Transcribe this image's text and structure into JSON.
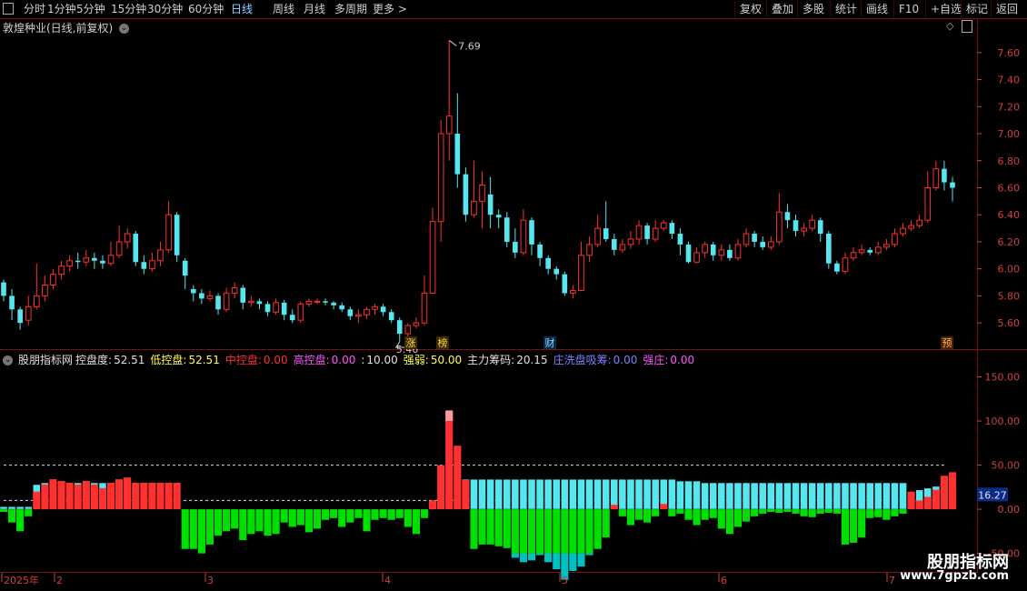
{
  "toolbar": {
    "periods": [
      "分时",
      "1分钟",
      "5分钟",
      "15分钟",
      "30分钟",
      "60分钟",
      "日线",
      "周线",
      "月线",
      "多周期",
      "更多 >"
    ],
    "active_period": "日线",
    "right_buttons": [
      "复权",
      "叠加",
      "多股",
      "统计",
      "画线",
      "F10",
      "+自选",
      "标记",
      "返回"
    ]
  },
  "price_panel": {
    "title": "敦煌种业(日线,前复权)",
    "axis_ticks": [
      "7.60",
      "7.40",
      "7.20",
      "7.00",
      "6.80",
      "6.60",
      "6.40",
      "6.20",
      "6.00",
      "5.80",
      "5.60"
    ],
    "high_label": "7.69",
    "low_label": "5.46",
    "tags": [
      {
        "text": "涨",
        "color": "#ffd24a",
        "bg": "#3a2a00"
      },
      {
        "text": "榜",
        "color": "#ffd24a",
        "bg": "#3a2a00"
      },
      {
        "text": "财",
        "color": "#8fd3ff",
        "bg": "#0a2a4a"
      },
      {
        "text": "预",
        "color": "#ffb060",
        "bg": "#4a2400"
      }
    ]
  },
  "indicator_panel": {
    "name": "股朋指标网",
    "fields": [
      {
        "label": "控盘度:",
        "value": "52.51",
        "color": "#e0e0e0"
      },
      {
        "label": "低控盘:",
        "value": "52.51",
        "color": "#ffff55"
      },
      {
        "label": "中控盘:",
        "value": "0.00",
        "color": "#ff3030"
      },
      {
        "label": "高控盘:",
        "value": "0.00",
        "color": "#ff55ff"
      },
      {
        "label": ":",
        "value": "10.00",
        "color": "#e0e0e0"
      },
      {
        "label": "强弱:",
        "value": "50.00",
        "color": "#ffff55"
      },
      {
        "label": "主力筹码:",
        "value": "20.15",
        "color": "#e0e0e0"
      },
      {
        "label": "庄洗盘吸筹:",
        "value": "0.00",
        "color": "#8080ff"
      },
      {
        "label": "强庄:",
        "value": "0.00",
        "color": "#ff55ff"
      }
    ],
    "axis_ticks": [
      "150.00",
      "100.00",
      "50.00",
      "0.00",
      "-50.00"
    ],
    "current_value": "16.27"
  },
  "date_axis": [
    "2025年",
    "2",
    "3",
    "4",
    "5",
    "6",
    "7"
  ],
  "watermark": {
    "cn": "股朋指标网",
    "url": "www.7gpzb.com"
  },
  "colors": {
    "up": "#ff3030",
    "down": "#55e6f0",
    "green": "#00e000",
    "teal": "#00c0c0",
    "grid": "#7a1010"
  },
  "chart_data": {
    "type": "candlestick",
    "series": [
      {
        "values": [
          [
            5.9,
            5.8,
            5.92,
            5.76
          ],
          [
            5.8,
            5.7,
            5.85,
            5.62
          ],
          [
            5.7,
            5.6,
            5.72,
            5.55
          ],
          [
            5.62,
            5.72,
            5.8,
            5.58
          ],
          [
            5.72,
            5.8,
            6.04,
            5.7
          ],
          [
            5.8,
            5.88,
            5.95,
            5.76
          ],
          [
            5.88,
            5.96,
            6.0,
            5.85
          ],
          [
            5.96,
            6.02,
            6.06,
            5.92
          ],
          [
            6.02,
            6.06,
            6.1,
            5.98
          ],
          [
            6.06,
            6.05,
            6.12,
            6.0
          ],
          [
            6.05,
            6.08,
            6.14,
            6.02
          ],
          [
            6.08,
            6.06,
            6.12,
            6.0
          ],
          [
            6.06,
            6.04,
            6.1,
            6.0
          ],
          [
            6.04,
            6.1,
            6.2,
            6.02
          ],
          [
            6.1,
            6.2,
            6.32,
            6.08
          ],
          [
            6.2,
            6.26,
            6.3,
            6.15
          ],
          [
            6.26,
            6.05,
            6.28,
            6.02
          ],
          [
            6.05,
            6.0,
            6.1,
            5.96
          ],
          [
            6.0,
            6.06,
            6.12,
            5.98
          ],
          [
            6.06,
            6.14,
            6.2,
            6.02
          ],
          [
            6.14,
            6.4,
            6.5,
            6.12
          ],
          [
            6.4,
            6.1,
            6.42,
            6.05
          ],
          [
            6.06,
            5.95,
            6.08,
            5.85
          ],
          [
            5.85,
            5.82,
            5.88,
            5.76
          ],
          [
            5.82,
            5.78,
            5.85,
            5.74
          ],
          [
            5.78,
            5.8,
            5.84,
            5.76
          ],
          [
            5.8,
            5.7,
            5.82,
            5.66
          ],
          [
            5.7,
            5.82,
            5.86,
            5.68
          ],
          [
            5.82,
            5.86,
            5.9,
            5.78
          ],
          [
            5.86,
            5.75,
            5.88,
            5.7
          ],
          [
            5.75,
            5.76,
            5.8,
            5.72
          ],
          [
            5.76,
            5.74,
            5.78,
            5.7
          ],
          [
            5.74,
            5.68,
            5.76,
            5.65
          ],
          [
            5.68,
            5.75,
            5.78,
            5.66
          ],
          [
            5.75,
            5.66,
            5.77,
            5.62
          ],
          [
            5.66,
            5.62,
            5.7,
            5.6
          ],
          [
            5.62,
            5.74,
            5.76,
            5.6
          ],
          [
            5.74,
            5.76,
            5.78,
            5.72
          ],
          [
            5.76,
            5.76,
            5.78,
            5.74
          ],
          [
            5.76,
            5.75,
            5.78,
            5.73
          ],
          [
            5.75,
            5.73,
            5.76,
            5.7
          ],
          [
            5.73,
            5.7,
            5.75,
            5.68
          ],
          [
            5.7,
            5.65,
            5.72,
            5.62
          ],
          [
            5.65,
            5.66,
            5.7,
            5.6
          ],
          [
            5.66,
            5.7,
            5.72,
            5.63
          ],
          [
            5.7,
            5.72,
            5.74,
            5.66
          ],
          [
            5.72,
            5.68,
            5.74,
            5.65
          ],
          [
            5.68,
            5.62,
            5.7,
            5.6
          ],
          [
            5.62,
            5.52,
            5.64,
            5.46
          ],
          [
            5.52,
            5.58,
            5.6,
            5.5
          ],
          [
            5.58,
            5.6,
            5.64,
            5.56
          ],
          [
            5.6,
            5.82,
            5.95,
            5.58
          ],
          [
            5.82,
            6.35,
            6.45,
            5.86
          ],
          [
            6.35,
            7.0,
            7.1,
            6.2
          ],
          [
            7.0,
            7.13,
            7.69,
            6.8
          ],
          [
            7.0,
            6.7,
            7.3,
            6.6
          ],
          [
            6.7,
            6.4,
            6.75,
            6.35
          ],
          [
            6.4,
            6.5,
            6.8,
            6.38
          ],
          [
            6.5,
            6.62,
            6.72,
            6.3
          ],
          [
            6.55,
            6.4,
            6.68,
            6.3
          ],
          [
            6.4,
            6.38,
            6.44,
            6.3
          ],
          [
            6.38,
            6.2,
            6.42,
            6.16
          ],
          [
            6.2,
            6.12,
            6.3,
            6.08
          ],
          [
            6.12,
            6.36,
            6.44,
            6.1
          ],
          [
            6.36,
            6.18,
            6.38,
            6.1
          ],
          [
            6.18,
            6.08,
            6.2,
            6.02
          ],
          [
            6.08,
            6.0,
            6.1,
            5.96
          ],
          [
            6.0,
            5.96,
            6.02,
            5.92
          ],
          [
            5.96,
            5.82,
            5.98,
            5.8
          ],
          [
            5.82,
            5.84,
            5.88,
            5.78
          ],
          [
            5.84,
            6.1,
            6.2,
            5.98
          ],
          [
            6.1,
            6.18,
            6.24,
            6.05
          ],
          [
            6.18,
            6.3,
            6.4,
            6.16
          ],
          [
            6.3,
            6.22,
            6.5,
            6.2
          ],
          [
            6.22,
            6.14,
            6.26,
            6.1
          ],
          [
            6.14,
            6.18,
            6.22,
            6.12
          ],
          [
            6.18,
            6.22,
            6.28,
            6.15
          ],
          [
            6.22,
            6.32,
            6.36,
            6.18
          ],
          [
            6.32,
            6.22,
            6.34,
            6.18
          ],
          [
            6.22,
            6.3,
            6.36,
            6.2
          ],
          [
            6.3,
            6.34,
            6.36,
            6.28
          ],
          [
            6.34,
            6.26,
            6.36,
            6.22
          ],
          [
            6.26,
            6.18,
            6.3,
            6.1
          ],
          [
            6.18,
            6.05,
            6.2,
            6.04
          ],
          [
            6.05,
            6.12,
            6.16,
            6.04
          ],
          [
            6.12,
            6.18,
            6.2,
            6.08
          ],
          [
            6.18,
            6.1,
            6.2,
            6.06
          ],
          [
            6.1,
            6.14,
            6.18,
            6.06
          ],
          [
            6.14,
            6.08,
            6.18,
            6.06
          ],
          [
            6.08,
            6.18,
            6.22,
            6.06
          ],
          [
            6.18,
            6.26,
            6.3,
            6.16
          ],
          [
            6.26,
            6.2,
            6.28,
            6.16
          ],
          [
            6.2,
            6.16,
            6.24,
            6.14
          ],
          [
            6.16,
            6.2,
            6.24,
            6.14
          ],
          [
            6.2,
            6.42,
            6.56,
            6.18
          ],
          [
            6.42,
            6.36,
            6.48,
            6.3
          ],
          [
            6.36,
            6.28,
            6.4,
            6.24
          ],
          [
            6.28,
            6.3,
            6.34,
            6.24
          ],
          [
            6.3,
            6.36,
            6.4,
            6.28
          ],
          [
            6.36,
            6.26,
            6.38,
            6.2
          ],
          [
            6.26,
            6.04,
            6.28,
            6.0
          ],
          [
            6.04,
            5.98,
            6.06,
            5.96
          ],
          [
            5.98,
            6.08,
            6.12,
            5.96
          ],
          [
            6.08,
            6.12,
            6.16,
            6.06
          ],
          [
            6.12,
            6.14,
            6.18,
            6.1
          ],
          [
            6.14,
            6.12,
            6.16,
            6.1
          ],
          [
            6.12,
            6.16,
            6.2,
            6.1
          ],
          [
            6.16,
            6.18,
            6.22,
            6.14
          ],
          [
            6.18,
            6.26,
            6.3,
            6.16
          ],
          [
            6.26,
            6.3,
            6.34,
            6.24
          ],
          [
            6.3,
            6.32,
            6.36,
            6.28
          ],
          [
            6.32,
            6.36,
            6.4,
            6.3
          ],
          [
            6.36,
            6.6,
            6.72,
            6.34
          ],
          [
            6.6,
            6.74,
            6.8,
            6.58
          ],
          [
            6.74,
            6.64,
            6.8,
            6.58
          ],
          [
            6.64,
            6.6,
            6.68,
            6.5
          ]
        ]
      }
    ],
    "ylim": [
      5.46,
      7.69
    ]
  },
  "indicator_data": {
    "type": "bar",
    "ylim": [
      -70,
      165
    ],
    "series": [
      {
        "name": "控盘度",
        "values": [
          -3,
          -15,
          -25,
          -8,
          20,
          28,
          34,
          32,
          30,
          28,
          32,
          28,
          24,
          30,
          34,
          36,
          30,
          30,
          30,
          30,
          30,
          30,
          -45,
          -45,
          -50,
          -40,
          -30,
          -25,
          -22,
          -35,
          -28,
          -25,
          -30,
          -28,
          -15,
          -20,
          -18,
          -26,
          -22,
          -12,
          -10,
          -20,
          -15,
          -10,
          -25,
          -12,
          -10,
          -12,
          -10,
          -20,
          -28,
          -10,
          10,
          50,
          100,
          72,
          33,
          -45,
          -40,
          -40,
          -42,
          -44,
          -55,
          -60,
          -58,
          -52,
          -60,
          -68,
          -80,
          -70,
          -65,
          -52,
          -45,
          -32,
          5,
          -8,
          -18,
          -12,
          -15,
          -8,
          6,
          -8,
          -5,
          -12,
          -18,
          -12,
          -10,
          -22,
          -28,
          -20,
          -14,
          -8,
          -5,
          -3,
          -4,
          -3,
          -5,
          -8,
          -9,
          -5,
          -4,
          -5,
          -40,
          -38,
          -32,
          -10,
          -9,
          -12,
          -8,
          -5,
          20,
          10,
          14,
          22,
          38,
          42,
          20,
          16
        ]
      },
      {
        "name": "主力筹码",
        "values": [
          3,
          3,
          3,
          3,
          28,
          30,
          30,
          30,
          30,
          30,
          30,
          30,
          30,
          30,
          30,
          30,
          30,
          30,
          30,
          30,
          30,
          30,
          0,
          0,
          0,
          0,
          0,
          0,
          0,
          0,
          0,
          0,
          0,
          0,
          0,
          0,
          0,
          0,
          0,
          0,
          0,
          0,
          0,
          0,
          0,
          0,
          0,
          0,
          0,
          0,
          0,
          0,
          0,
          0,
          0,
          34,
          34,
          34,
          34,
          34,
          34,
          34,
          34,
          34,
          34,
          34,
          34,
          34,
          34,
          34,
          34,
          34,
          34,
          34,
          34,
          34,
          34,
          34,
          34,
          34,
          34,
          34,
          32,
          32,
          32,
          30,
          30,
          30,
          30,
          30,
          30,
          30,
          30,
          30,
          30,
          30,
          30,
          30,
          30,
          30,
          30,
          30,
          30,
          30,
          30,
          30,
          30,
          30,
          30,
          30,
          20,
          22,
          24,
          26,
          28,
          30,
          30,
          30
        ]
      }
    ]
  }
}
